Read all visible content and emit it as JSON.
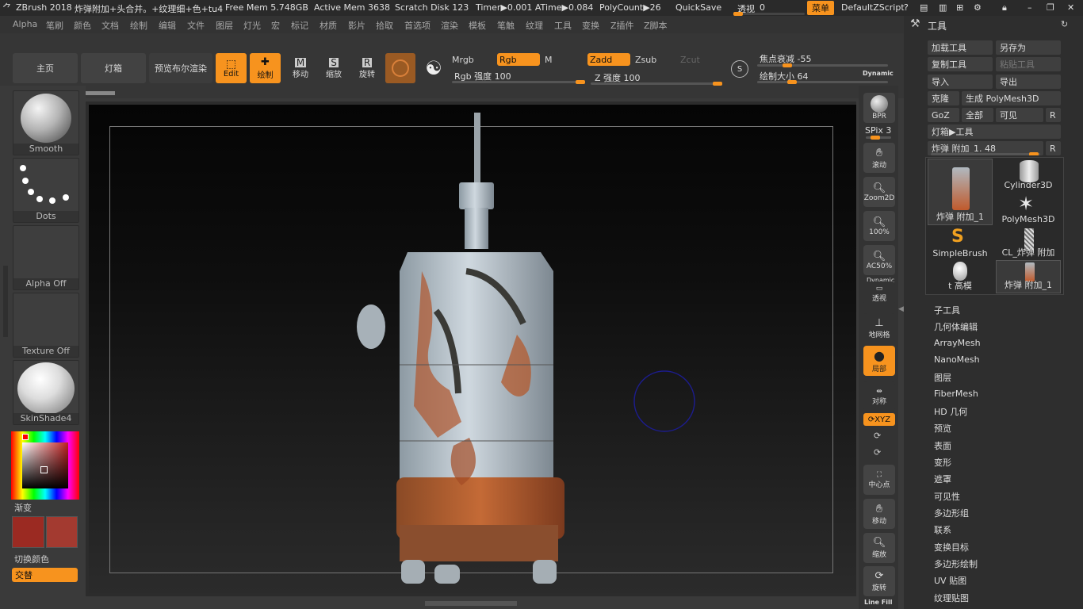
{
  "titlebar": {
    "app": "ZBrush 2018",
    "doc": "炸弹附加+头合并。+纹理细+色+tu4",
    "free_mem": "Free Mem 5.748GB",
    "active_mem": "Active Mem 3638",
    "scratch": "Scratch Disk 123",
    "timer": "Timer▶0.001 ATime▶0.084",
    "polycount": "PolyCount▶26",
    "quicksave": "QuickSave",
    "transp_label": "透视",
    "transp_value": "0",
    "menu_btn": "菜单",
    "script": "DefaultZScript"
  },
  "menubar": [
    "Alpha",
    "笔刷",
    "颜色",
    "文档",
    "绘制",
    "编辑",
    "文件",
    "图层",
    "灯光",
    "宏",
    "标记",
    "材质",
    "影片",
    "拾取",
    "首选项",
    "渲染",
    "模板",
    "笔触",
    "纹理",
    "工具",
    "变换",
    "Z插件",
    "Z脚本"
  ],
  "toolbar": {
    "home": "主页",
    "lightbox": "灯箱",
    "bpr": "预览布尔渲染",
    "edit": "Edit",
    "draw": "绘制",
    "move": "移动",
    "scale": "缩放",
    "rotate": "旋转",
    "mrgb": "Mrgb",
    "rgb": "Rgb",
    "m": "M",
    "zadd": "Zadd",
    "zsub": "Zsub",
    "zcut": "Zcut",
    "rgb_intensity": "Rgb 强度 100",
    "z_intensity": "Z 强度 100",
    "focal": "焦点衰减 -55",
    "draw_size": "绘制大小 64",
    "dynamic": "Dynamic"
  },
  "leftpanel": {
    "brush": "Smooth",
    "stroke": "Dots",
    "alpha": "Alpha Off",
    "texture": "Texture Off",
    "material": "SkinShade4",
    "gradient": "渐变",
    "switch_color": "切换颜色",
    "alternate": "交替"
  },
  "rightdock": {
    "bpr": "BPR",
    "spix": "SPix 3",
    "scroll": "滚动",
    "zoom2d": "Zoom2D",
    "pct100": "100%",
    "ac50": "AC50%",
    "dynamic": "Dynamic",
    "persp": "透视",
    "floor": "地网格",
    "local": "局部",
    "sym": "对称",
    "xyz": "XYZ",
    "center": "中心点",
    "move": "移动",
    "zoom": "缩放",
    "rotate": "旋转",
    "linefill": "Line Fill"
  },
  "toolpanel": {
    "title": "工具",
    "load": "加载工具",
    "saveas": "另存为",
    "copy": "复制工具",
    "paste": "粘贴工具",
    "import": "导入",
    "export": "导出",
    "clone": "克隆",
    "make_poly": "生成 PolyMesh3D",
    "goz": "GoZ",
    "all": "全部",
    "visible": "可见",
    "r": "R",
    "lightbox_tool": "灯箱▶工具",
    "current_tool": "炸弹 附加_1. 48",
    "tools": [
      "炸弹 附加_1",
      "Cylinder3D",
      "PolyMesh3D",
      "SimpleBrush",
      "CL_炸弹 附加",
      "t 高模",
      "炸弹 附加_1"
    ],
    "subpalettes": [
      "子工具",
      "几何体编辑",
      "ArrayMesh",
      "NanoMesh",
      "图层",
      "FiberMesh",
      "HD 几何",
      "预览",
      "表面",
      "变形",
      "遮罩",
      "可见性",
      "多边形组",
      "联系",
      "变换目标",
      "多边形绘制",
      "UV 贴图",
      "纹理贴图"
    ]
  },
  "colors": {
    "accent": "#f7931e",
    "primary_color": "#9b2a22",
    "secondary_color": "#a33a30"
  }
}
